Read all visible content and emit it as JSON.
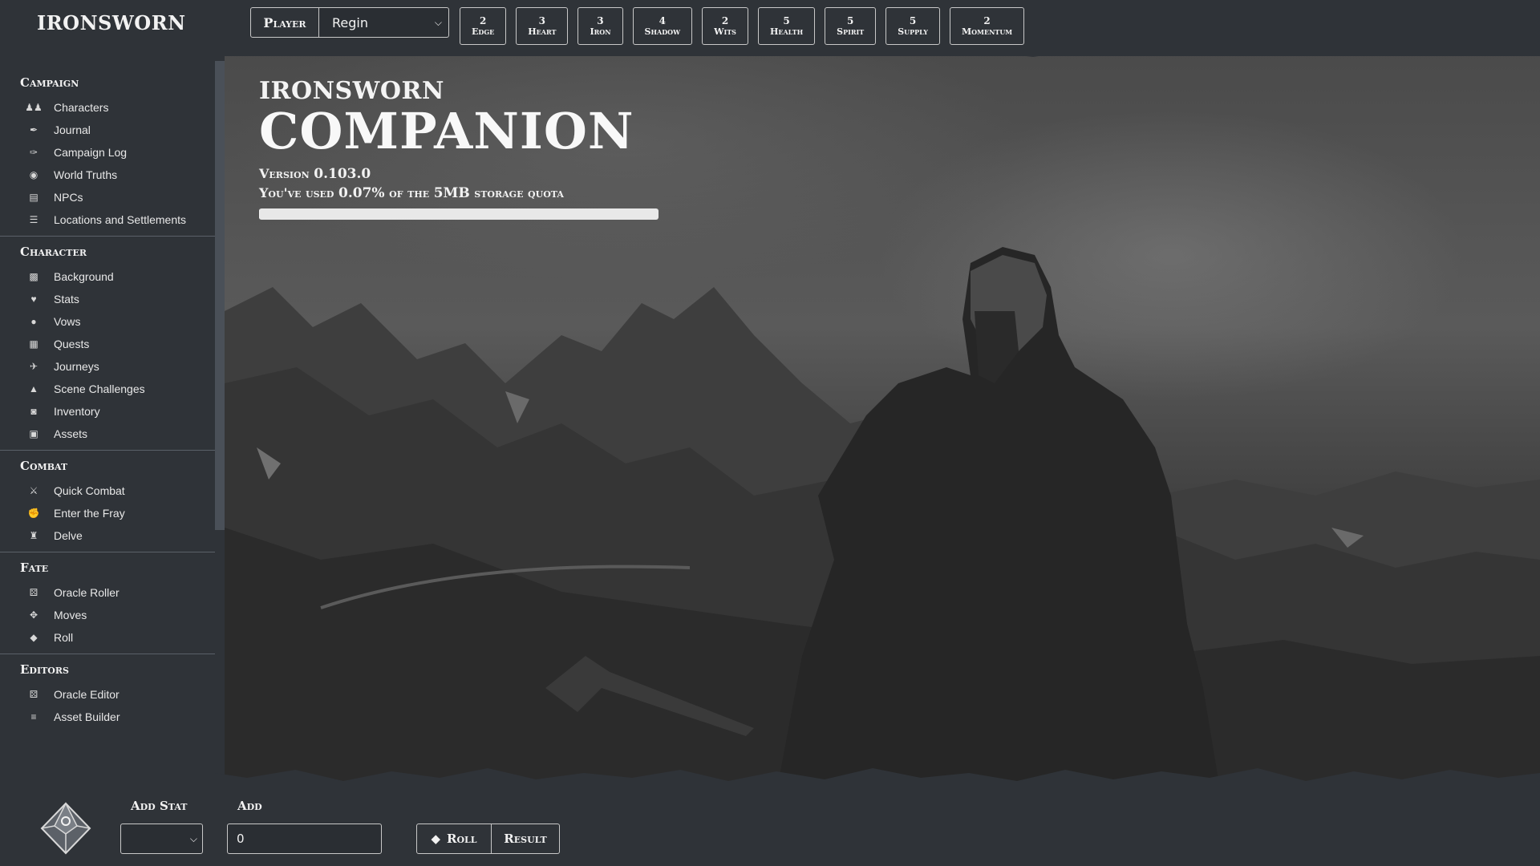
{
  "brand": "IRONSWORN",
  "player": {
    "label": "Player",
    "selected": "Regin"
  },
  "stats": [
    {
      "value": "2",
      "label": "Edge"
    },
    {
      "value": "3",
      "label": "Heart"
    },
    {
      "value": "3",
      "label": "Iron"
    },
    {
      "value": "4",
      "label": "Shadow"
    },
    {
      "value": "2",
      "label": "Wits"
    },
    {
      "value": "5",
      "label": "Health"
    },
    {
      "value": "5",
      "label": "Spirit"
    },
    {
      "value": "5",
      "label": "Supply"
    },
    {
      "value": "2",
      "label": "Momentum"
    }
  ],
  "sidebar": {
    "sections": [
      {
        "title": "Campaign",
        "items": [
          {
            "label": "Characters",
            "icon": "users-icon"
          },
          {
            "label": "Journal",
            "icon": "feather-icon"
          },
          {
            "label": "Campaign Log",
            "icon": "quill-icon"
          },
          {
            "label": "World Truths",
            "icon": "globe-icon"
          },
          {
            "label": "NPCs",
            "icon": "id-badge-icon"
          },
          {
            "label": "Locations and Settlements",
            "icon": "signpost-icon"
          }
        ]
      },
      {
        "title": "Character",
        "items": [
          {
            "label": "Background",
            "icon": "id-card-icon"
          },
          {
            "label": "Stats",
            "icon": "heart-pulse-icon"
          },
          {
            "label": "Vows",
            "icon": "speech-bubble-icon"
          },
          {
            "label": "Quests",
            "icon": "scroll-icon"
          },
          {
            "label": "Journeys",
            "icon": "hiker-icon"
          },
          {
            "label": "Scene Challenges",
            "icon": "campfire-icon"
          },
          {
            "label": "Inventory",
            "icon": "sack-icon"
          },
          {
            "label": "Assets",
            "icon": "toolbox-icon"
          }
        ]
      },
      {
        "title": "Combat",
        "items": [
          {
            "label": "Quick Combat",
            "icon": "crossed-swords-icon"
          },
          {
            "label": "Enter the Fray",
            "icon": "fist-icon"
          },
          {
            "label": "Delve",
            "icon": "dungeon-icon"
          }
        ]
      },
      {
        "title": "Fate",
        "items": [
          {
            "label": "Oracle Roller",
            "icon": "dice-icon"
          },
          {
            "label": "Moves",
            "icon": "arrows-icon"
          },
          {
            "label": "Roll",
            "icon": "d10-icon"
          }
        ]
      },
      {
        "title": "Editors",
        "items": [
          {
            "label": "Oracle Editor",
            "icon": "dice-icon"
          },
          {
            "label": "Asset Builder",
            "icon": "layers-icon"
          }
        ]
      }
    ]
  },
  "hero": {
    "title": "IRONSWORN",
    "subtitle": "COMPANION",
    "version_label": "Version",
    "version": "0.103.0",
    "quota_prefix": "You've used",
    "quota_percent": "0.07%",
    "quota_mid": "of the",
    "quota_size": "5MB",
    "quota_suffix": "storage quota",
    "quota_fraction": 0.0007
  },
  "bottom": {
    "add_stat_label": "Add Stat",
    "add_stat_value": "",
    "add_label": "Add",
    "add_value": "0",
    "roll_label": "Roll",
    "result_label": "Result"
  },
  "colors": {
    "background": "#2f3338",
    "text": "#f2f2f2",
    "border": "#c8c8c8"
  }
}
